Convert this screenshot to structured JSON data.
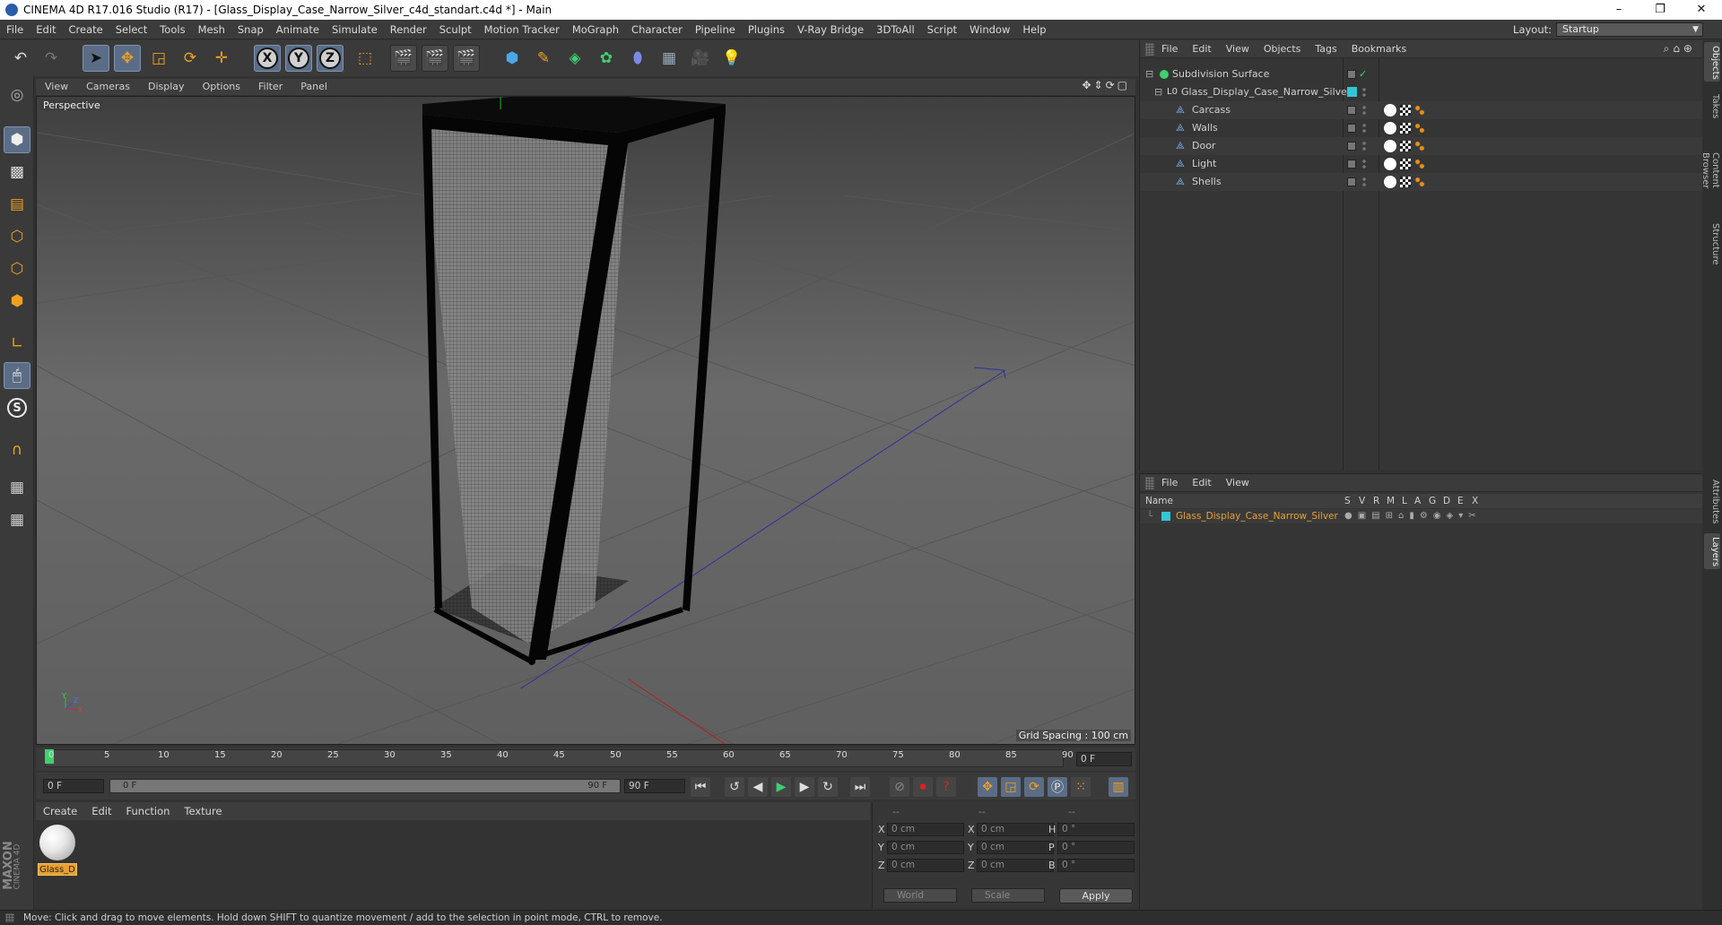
{
  "window": {
    "title": "CINEMA 4D R17.016 Studio (R17) - [Glass_Display_Case_Narrow_Silver_c4d_standart.c4d *] - Main",
    "minimize": "–",
    "maximize": "❐",
    "close": "✕"
  },
  "menu": [
    "File",
    "Edit",
    "Create",
    "Select",
    "Tools",
    "Mesh",
    "Snap",
    "Animate",
    "Simulate",
    "Render",
    "Sculpt",
    "Motion Tracker",
    "MoGraph",
    "Character",
    "Pipeline",
    "Plugins",
    "V-Ray Bridge",
    "3DToAll",
    "Script",
    "Window",
    "Help"
  ],
  "layout": {
    "label": "Layout:",
    "value": "Startup"
  },
  "toolbar": {
    "x": "X",
    "y": "Y",
    "z": "Z"
  },
  "viewport": {
    "menu": [
      "View",
      "Cameras",
      "Display",
      "Options",
      "Filter",
      "Panel"
    ],
    "label": "Perspective",
    "grid_spacing": "Grid Spacing : 100 cm",
    "axis_x": "X",
    "axis_y": "Y",
    "axis_z": "Z"
  },
  "timeline": {
    "ticks": [
      "0",
      "5",
      "10",
      "15",
      "20",
      "25",
      "30",
      "35",
      "40",
      "45",
      "50",
      "55",
      "60",
      "65",
      "70",
      "75",
      "80",
      "85",
      "90"
    ],
    "current_frame": "0 F",
    "start_field": "0 F",
    "range_start": "0 F",
    "range_end": "90 F",
    "end_field": "90 F"
  },
  "material_manager": {
    "menu": [
      "Create",
      "Edit",
      "Function",
      "Texture"
    ],
    "material_name": "Glass_D",
    "logo_top": "MAXON",
    "logo_bottom": "CINEMA 4D"
  },
  "coordinates": {
    "col_headers": [
      "--",
      "--",
      "--"
    ],
    "rows": [
      {
        "a": "X",
        "av": "0 cm",
        "b": "X",
        "bv": "0 cm",
        "c": "H",
        "cv": "0 °"
      },
      {
        "a": "Y",
        "av": "0 cm",
        "b": "Y",
        "bv": "0 cm",
        "c": "P",
        "cv": "0 °"
      },
      {
        "a": "Z",
        "av": "0 cm",
        "b": "Z",
        "bv": "0 cm",
        "c": "B",
        "cv": "0 °"
      }
    ],
    "world": "World",
    "scale": "Scale",
    "apply": "Apply"
  },
  "object_manager": {
    "menu": [
      "File",
      "Edit",
      "View",
      "Objects",
      "Tags",
      "Bookmarks"
    ],
    "objects": [
      {
        "name": "Subdivision Surface",
        "level": 0
      },
      {
        "name": "Glass_Display_Case_Narrow_Silver",
        "level": 1
      },
      {
        "name": "Carcass",
        "level": 2
      },
      {
        "name": "Walls",
        "level": 2
      },
      {
        "name": "Door",
        "level": 2
      },
      {
        "name": "Light",
        "level": 2
      },
      {
        "name": "Shells",
        "level": 2
      }
    ]
  },
  "layer_manager": {
    "menu": [
      "File",
      "Edit",
      "View"
    ],
    "columns": [
      "Name",
      "S",
      "V",
      "R",
      "M",
      "L",
      "A",
      "G",
      "D",
      "E",
      "X"
    ],
    "layer_name": "Glass_Display_Case_Narrow_Silver",
    "layer_color": "#33c6d6"
  },
  "side_tabs": [
    "Objects",
    "Takes",
    "Content Browser",
    "Structure",
    "Attributes",
    "Layers"
  ],
  "status": "Move: Click and drag to move elements. Hold down SHIFT to quantize movement / add to the selection in point mode, CTRL to remove.",
  "colors": {
    "accent": "#e8a030",
    "selection": "#5b6d86",
    "layer": "#33c6d6"
  }
}
